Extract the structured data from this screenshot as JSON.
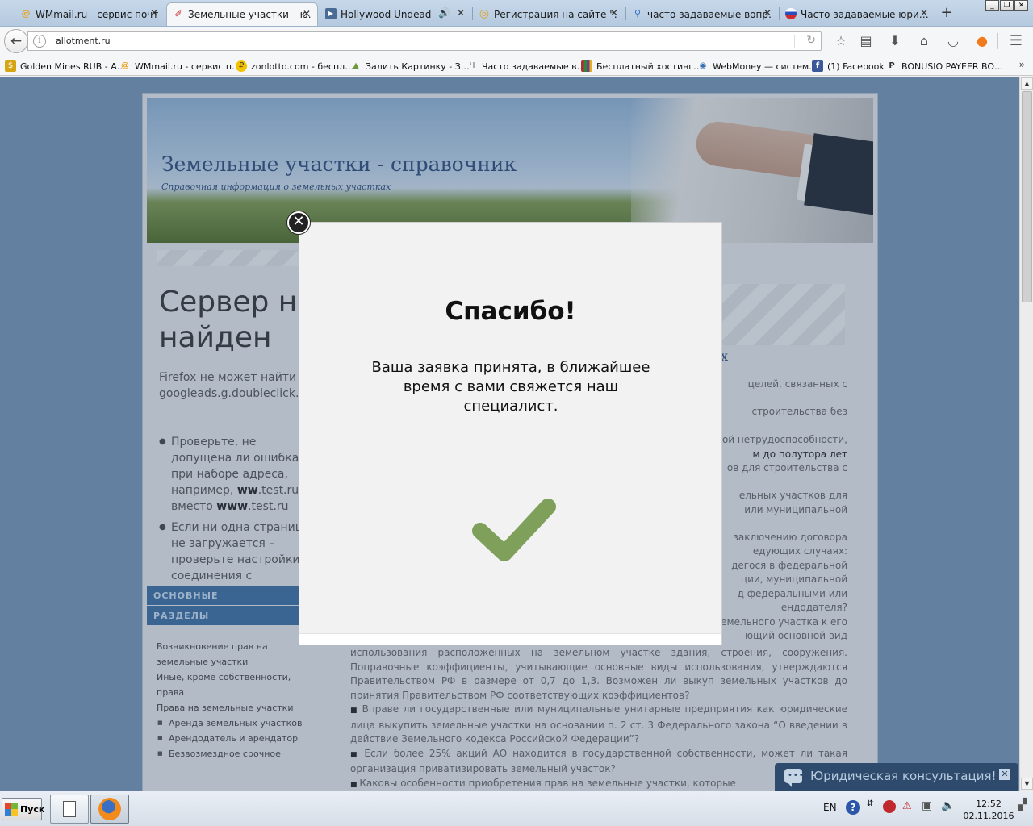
{
  "window": {
    "tabs": [
      {
        "label": "WMmail.ru - сервис почт…",
        "icon": "wmmail-icon",
        "active": false
      },
      {
        "label": "Земельные участки – ю…",
        "icon": "pen-icon",
        "active": true
      },
      {
        "label": "Hollywood Undead -",
        "icon": "video-icon",
        "active": false
      },
      {
        "label": "Регистрация на сайте \"…",
        "icon": "chrome-icon",
        "active": false
      },
      {
        "label": "часто задаваемые вопр…",
        "icon": "search-icon",
        "active": false
      },
      {
        "label": "Часто задаваемые юри…",
        "icon": "flag-ru-icon",
        "active": false
      }
    ],
    "new_tab": "+",
    "controls": {
      "minimize": "_",
      "restore": "❐",
      "close": "✕"
    }
  },
  "navbar": {
    "url": "allotment.ru",
    "back": "←",
    "reload": "↻",
    "icons": [
      "star-icon",
      "reading-list-icon",
      "download-icon",
      "home-icon",
      "pocket-icon",
      "firefox-sync-icon",
      "menu-icon"
    ]
  },
  "bookmarks": [
    {
      "label": "Golden Mines RUB - A…",
      "icon": "golden-mines-icon",
      "color": "#d6a514",
      "glyph": "$"
    },
    {
      "label": "WMmail.ru - сервис п…",
      "icon": "wmmail-icon",
      "color": "#e8a020",
      "glyph": "@"
    },
    {
      "label": "zonlotto.com - беспл…",
      "icon": "zonlotto-icon",
      "color": "#f2c200",
      "glyph": "₽"
    },
    {
      "label": "Залить Картинку - З…",
      "icon": "image-upload-icon",
      "color": "#6c9a3c",
      "glyph": "▲"
    },
    {
      "label": "Часто задаваемые в…",
      "icon": "faq-icon",
      "color": "#8a8a8a",
      "glyph": "Ч"
    },
    {
      "label": "Бесплатный хостинг…",
      "icon": "hosting-icon",
      "color": "#7a3a8a",
      "glyph": "▌"
    },
    {
      "label": "WebMoney — систем…",
      "icon": "webmoney-icon",
      "color": "#3b6fb6",
      "glyph": "◉"
    },
    {
      "label": "(1) Facebook",
      "icon": "facebook-icon",
      "color": "#3b5998",
      "glyph": "f"
    },
    {
      "label": "BONUSIO PAYEER BO…",
      "icon": "payeer-icon",
      "color": "#333333",
      "glyph": "P"
    }
  ],
  "bookmarks_more": "»",
  "site": {
    "title": "Земельные участки - справочник",
    "subtitle": "Справочная информация о земельных участках",
    "error_heading": "Сервер не найден",
    "error_text": "Firefox не может найти сервер googleads.g.doubleclick.net",
    "error_tips": [
      {
        "pre": "Проверьте, не допущена ли ошибка при наборе адреса, например,",
        "bold1": "ww",
        "mid1": ".test.ru вместо",
        "bold2": "www",
        "post": ".test.ru"
      },
      {
        "text": "Если ни одна страница не загружается – проверьте настройки соединения с Интернетом."
      }
    ],
    "side_blocks": [
      "ОСНОВНЫЕ",
      "РАЗДЕЛЫ"
    ],
    "side_links": [
      {
        "label": "Возникновение прав на земельные участки",
        "sub": false
      },
      {
        "label": "Иные, кроме собственности, права",
        "sub": false
      },
      {
        "label": "Права на земельные участки",
        "sub": false
      },
      {
        "label": "Аренда земельных участков",
        "sub": true
      },
      {
        "label": "Арендодатель и арендатор",
        "sub": true
      },
      {
        "label": "Безвозмездное срочное",
        "sub": true
      }
    ],
    "main_fragments": [
      "х",
      "целей, связанных с",
      "строительства без",
      "ой нетрудоспособности,",
      "м до полутора лет",
      "ов для строительства с",
      "ельных участков для",
      "или муниципальной",
      "заключению договора",
      "едующих случаях:",
      "дегося в федеральной",
      "ции, муниципальной",
      "д федеральными или",
      "ендодателя?",
      "емельного участка к его",
      "ющий основной вид"
    ],
    "main_paragraphs": [
      "использования расположенных на земельном участке здания, строения, сооружения. Поправочные коэффициенты, учитывающие основные виды использования, утверждаются Правительством РФ в размере от 0,7 до 1,3. Возможен ли выкуп земельных участков до принятия Правительством РФ соответствующих коэффициентов?",
      "Вправе ли государственные или муниципальные унитарные предприятия как юридические лица выкупить земельные участки на основании п. 2 ст. 3 Федерального закона “О введении в действие Земельного кодекса Российской Федерации”?",
      "Если более 25% акций АО находится в государственной собственности, может ли такая организация приватизировать земельный участок?",
      "Каковы особенности приобретения прав на земельные участки, которые"
    ]
  },
  "modal": {
    "title": "Спасибо!",
    "message": "Ваша заявка принята, в ближайшее время с вами свяжется наш специалист.",
    "check_color": "#7fa05a"
  },
  "chat": {
    "label": "Юридическая консультация!",
    "close": "✕"
  },
  "taskbar": {
    "start_label": "Пуск",
    "lang": "EN",
    "time": "12:52",
    "date": "02.11.2016"
  }
}
